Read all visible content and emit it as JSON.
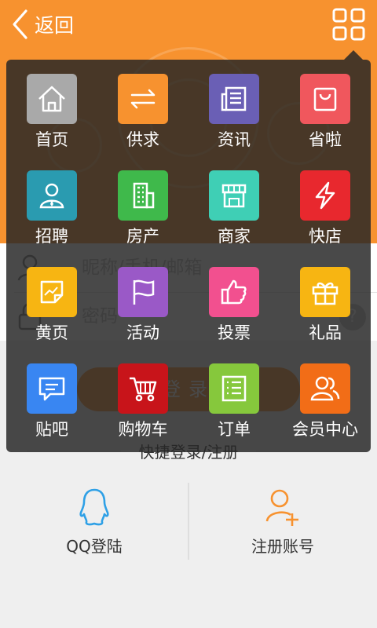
{
  "topbar": {
    "back_label": "返回",
    "brand_color": "#f7922f"
  },
  "login": {
    "username_placeholder": "昵称/手机/邮箱",
    "password_placeholder": "密码",
    "help_label": "?",
    "login_button": "登录"
  },
  "quick_login": {
    "title": "快捷登录/注册",
    "items": [
      {
        "label": "QQ登陆",
        "icon": "qq-icon"
      },
      {
        "label": "注册账号",
        "icon": "add-user-icon"
      }
    ]
  },
  "menu": {
    "items": [
      {
        "label": "首页",
        "icon": "home-icon",
        "color": "#a9a9a9"
      },
      {
        "label": "供求",
        "icon": "exchange-icon",
        "color": "#f7922f"
      },
      {
        "label": "资讯",
        "icon": "news-icon",
        "color": "#6a5fb5"
      },
      {
        "label": "省啦",
        "icon": "shopping-bag-icon",
        "color": "#f0575d"
      },
      {
        "label": "招聘",
        "icon": "person-icon",
        "color": "#2a9bb0"
      },
      {
        "label": "房产",
        "icon": "building-icon",
        "color": "#3fb94b"
      },
      {
        "label": "商家",
        "icon": "storefront-icon",
        "color": "#3fcfb5"
      },
      {
        "label": "快店",
        "icon": "lightning-icon",
        "color": "#e8282e"
      },
      {
        "label": "黄页",
        "icon": "chart-note-icon",
        "color": "#f7b512"
      },
      {
        "label": "活动",
        "icon": "flag-icon",
        "color": "#9a59c7"
      },
      {
        "label": "投票",
        "icon": "thumbs-up-icon",
        "color": "#f2508f"
      },
      {
        "label": "礼品",
        "icon": "gift-icon",
        "color": "#f7b512"
      },
      {
        "label": "贴吧",
        "icon": "chat-icon",
        "color": "#3986f2"
      },
      {
        "label": "购物车",
        "icon": "cart-icon",
        "color": "#c8141a"
      },
      {
        "label": "订单",
        "icon": "order-list-icon",
        "color": "#86c83c"
      },
      {
        "label": "会员中心",
        "icon": "members-icon",
        "color": "#f26d17"
      }
    ]
  }
}
